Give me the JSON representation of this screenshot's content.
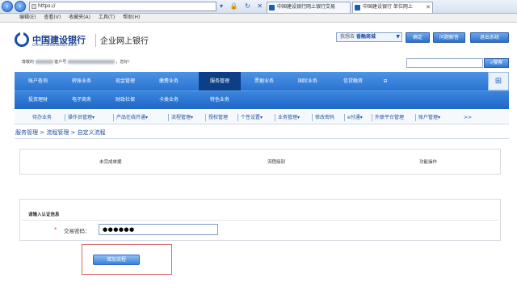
{
  "browser": {
    "address": "https://",
    "tabs": [
      {
        "label": "中国建设银行网上银行交易"
      },
      {
        "label": "中国建设银行 单位网上"
      }
    ],
    "menu": [
      "编辑(E)",
      "查看(V)",
      "收藏夹(A)",
      "工具(T)",
      "帮助(H)"
    ]
  },
  "header": {
    "logo_cn": "中国建设银行",
    "logo_en": "China Construction Bank",
    "site_name": "企业网上银行",
    "goto_prefix": "我想去",
    "goto_value": "香融商城",
    "confirm": "确定",
    "help": "问题解答",
    "logout": "退出系统",
    "greeting_prefix": "尊敬的",
    "greeting_mid": "客户号",
    "greeting_suffix": "，您好!",
    "search_btn": "搜索"
  },
  "main_nav": [
    "账户查询",
    "转账业务",
    "现金管理",
    "缴费业务",
    "服务管理",
    "票据业务",
    "国际业务",
    "信贷融资"
  ],
  "sub_nav": [
    "投资理财",
    "电子商务",
    "财政社保",
    "卡类业务",
    "特色业务"
  ],
  "third_nav": [
    "待办业务",
    "操作员管理▾",
    "产品在线开通▾",
    "流程管理▾",
    "授权管理",
    "个性设置▾",
    "业务管理▾",
    "修改密码",
    "e付通▾",
    "外联平台管理",
    "账户管理▾",
    ">>"
  ],
  "breadcrumb": "服务管理 > 流程管理 > 自定义流程",
  "flow_table": {
    "headers": [
      "未完成单据",
      "流程级别",
      "功能操作"
    ]
  },
  "auth": {
    "title": "请输入认证信息",
    "required_mark": "*",
    "password_label": "交易密码：",
    "password_value": "●●●●●●"
  },
  "add_flow_button": "增加流程"
}
